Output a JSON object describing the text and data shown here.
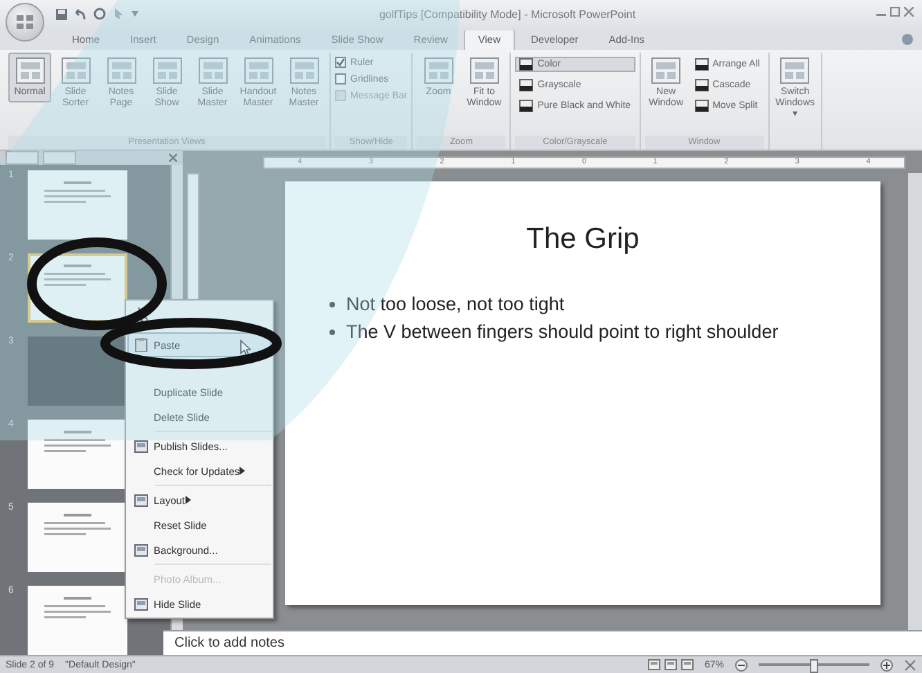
{
  "window": {
    "title": "golfTips [Compatibility Mode] - Microsoft PowerPoint"
  },
  "tabs": [
    {
      "label": "Home",
      "selected": false
    },
    {
      "label": "Insert",
      "selected": false
    },
    {
      "label": "Design",
      "selected": false
    },
    {
      "label": "Animations",
      "selected": false
    },
    {
      "label": "Slide Show",
      "selected": false
    },
    {
      "label": "Review",
      "selected": false
    },
    {
      "label": "View",
      "selected": true
    },
    {
      "label": "Developer",
      "selected": false
    },
    {
      "label": "Add-Ins",
      "selected": false
    }
  ],
  "ribbon": {
    "groups": [
      {
        "label": "Presentation Views",
        "items": [
          {
            "kind": "large",
            "label": "Normal",
            "selected": true
          },
          {
            "kind": "large",
            "label": "Slide Sorter",
            "selected": false
          },
          {
            "kind": "large",
            "label": "Notes Page",
            "selected": false
          },
          {
            "kind": "large",
            "label": "Slide Show",
            "selected": false
          },
          {
            "kind": "large",
            "label": "Slide Master",
            "selected": false
          },
          {
            "kind": "large",
            "label": "Handout Master",
            "selected": false
          },
          {
            "kind": "large",
            "label": "Notes Master",
            "selected": false
          }
        ]
      },
      {
        "label": "Show/Hide",
        "items": [
          {
            "kind": "check",
            "label": "Ruler",
            "checked": true,
            "disabled": false
          },
          {
            "kind": "check",
            "label": "Gridlines",
            "checked": false,
            "disabled": false
          },
          {
            "kind": "check",
            "label": "Message Bar",
            "checked": false,
            "disabled": true
          }
        ]
      },
      {
        "label": "Zoom",
        "items": [
          {
            "kind": "large",
            "label": "Zoom",
            "selected": false
          },
          {
            "kind": "large",
            "label": "Fit to Window",
            "selected": false
          }
        ]
      },
      {
        "label": "Color/Grayscale",
        "items": [
          {
            "kind": "small",
            "label": "Color",
            "selected": true
          },
          {
            "kind": "small",
            "label": "Grayscale",
            "selected": false
          },
          {
            "kind": "small",
            "label": "Pure Black and White",
            "selected": false
          }
        ]
      },
      {
        "label": "Window",
        "items": [
          {
            "kind": "large",
            "label": "New Window",
            "selected": false
          },
          {
            "kind": "small",
            "label": "Arrange All",
            "selected": false
          },
          {
            "kind": "small",
            "label": "Cascade",
            "selected": false
          },
          {
            "kind": "small",
            "label": "Move Split",
            "selected": false
          }
        ]
      },
      {
        "items": [
          {
            "kind": "large",
            "label": "Switch Windows ▾",
            "selected": false
          }
        ]
      }
    ]
  },
  "slides_panel": {
    "thumbnails": [
      {
        "number": "1",
        "kind": "text",
        "selected": false
      },
      {
        "number": "2",
        "kind": "text",
        "selected": true
      },
      {
        "number": "3",
        "kind": "photo",
        "selected": false
      },
      {
        "number": "4",
        "kind": "text",
        "selected": false
      },
      {
        "number": "5",
        "kind": "text",
        "selected": false
      },
      {
        "number": "6",
        "kind": "text",
        "selected": false
      }
    ]
  },
  "ruler_labels": [
    "4",
    "3",
    "2",
    "1",
    "0",
    "1",
    "2",
    "3",
    "4"
  ],
  "slide": {
    "title": "The Grip",
    "bullets": [
      "Not too loose, not too tight",
      "The V between fingers should point to right shoulder"
    ]
  },
  "notes": {
    "placeholder": "Click to add notes"
  },
  "context_menu": {
    "items": [
      {
        "kind": "icon",
        "selected": false
      },
      {
        "kind": "command",
        "label": "Paste",
        "selected": true,
        "disabled": false,
        "separator_after": false
      },
      {
        "kind": "command",
        "label": "Duplicate Slide",
        "selected": false,
        "disabled": false,
        "separator_after": false
      },
      {
        "kind": "command",
        "label": "Delete Slide",
        "selected": false,
        "disabled": false,
        "separator_after": true
      },
      {
        "kind": "command",
        "label": "Publish Slides...",
        "selected": false,
        "disabled": false,
        "separator_after": false
      },
      {
        "kind": "submenu",
        "label": "Check for Updates",
        "selected": false,
        "disabled": false,
        "separator_after": true
      },
      {
        "kind": "submenu",
        "label": "Layout",
        "selected": false,
        "disabled": false,
        "separator_after": false
      },
      {
        "kind": "command",
        "label": "Reset Slide",
        "selected": false,
        "disabled": false,
        "separator_after": false
      },
      {
        "kind": "command",
        "label": "Background...",
        "selected": false,
        "disabled": false,
        "separator_after": true
      },
      {
        "kind": "command",
        "label": "Photo Album...",
        "selected": false,
        "disabled": true,
        "separator_after": false
      },
      {
        "kind": "command",
        "label": "Hide Slide",
        "selected": false,
        "disabled": false,
        "separator_after": false
      }
    ]
  },
  "status_bar": {
    "slide": "Slide 2 of 9",
    "theme": "\"Default Design\"",
    "zoom": "67%",
    "zoom_level": {
      "level": 0.5
    }
  }
}
